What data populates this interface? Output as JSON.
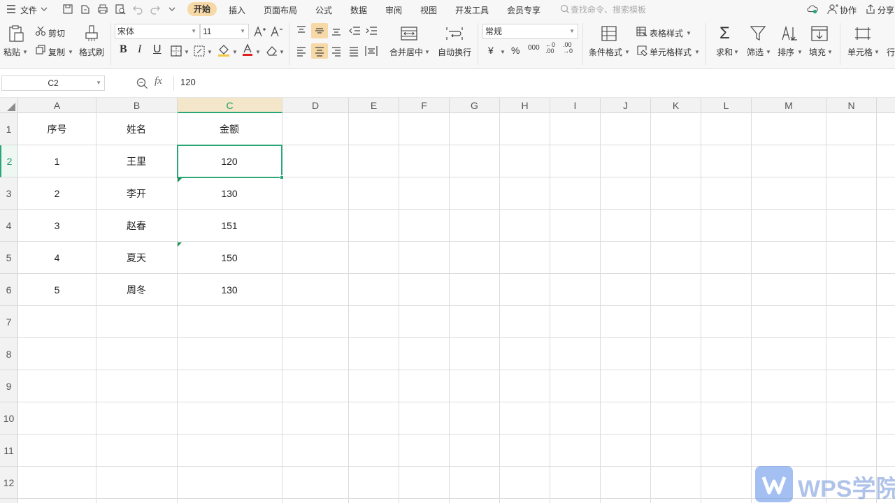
{
  "menubar": {
    "file_label": "文件",
    "tabs": [
      "开始",
      "插入",
      "页面布局",
      "公式",
      "数据",
      "审阅",
      "视图",
      "开发工具",
      "会员专享"
    ],
    "search_placeholder": "查找命令、搜索模板",
    "collab_label": "协作",
    "share_label": "分享"
  },
  "ribbon": {
    "paste": "粘贴",
    "cut": "剪切",
    "copy": "复制",
    "format_painter": "格式刷",
    "font_name": "宋体",
    "font_size": "11",
    "merge_center": "合并居中",
    "wrap_text": "自动换行",
    "number_format": "常规",
    "conditional_format": "条件格式",
    "table_style": "表格样式",
    "cell_style": "单元格样式",
    "sum": "求和",
    "filter": "筛选",
    "sort": "排序",
    "fill": "填充",
    "cell": "单元格",
    "row_col": "行"
  },
  "formula_bar": {
    "cell_ref": "C2",
    "fx": "fx",
    "value": "120"
  },
  "sheet": {
    "columns": [
      "A",
      "B",
      "C",
      "D",
      "E",
      "F",
      "G",
      "H",
      "I",
      "J",
      "K",
      "L",
      "M",
      "N"
    ],
    "rows": [
      "1",
      "2",
      "3",
      "4",
      "5",
      "6",
      "7",
      "8",
      "9",
      "10",
      "11",
      "12"
    ],
    "selected_column": "C",
    "selected_row": "2",
    "cells": {
      "A1": "序号",
      "B1": "姓名",
      "C1": "金额",
      "A2": "1",
      "B2": "王里",
      "C2": "120",
      "A3": "2",
      "B3": "李开",
      "C3": "130",
      "A4": "3",
      "B4": "赵春",
      "C4": "151",
      "A5": "4",
      "B5": "夏天",
      "C5": "150",
      "A6": "5",
      "B6": "周冬",
      "C6": "130"
    }
  },
  "watermark": {
    "text": "WPS学院"
  },
  "colors": {
    "accent_green": "#2aa776",
    "home_tab": "#f6d9a6",
    "font_color_bar": "#e02020",
    "fill_color_bar": "#f5c842"
  }
}
